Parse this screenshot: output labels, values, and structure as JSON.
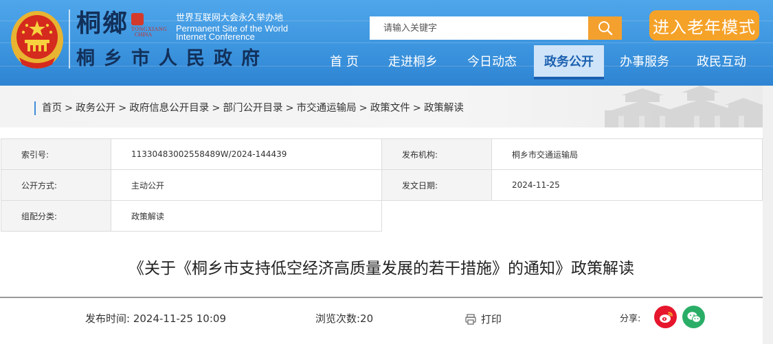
{
  "header": {
    "logo_calligraphy": "桐鄉",
    "logo_seal_en_1": "TONGXIANG",
    "logo_seal_en_2": "CHINA",
    "wic_cn": "世界互联网大会永久举办地",
    "wic_en_1": "Permanent Site of the World",
    "wic_en_2": "Internet Conference",
    "gov_name": "桐乡市人民政府",
    "search_placeholder": "请输入关键字",
    "elder_mode": "进入老年模式"
  },
  "nav": {
    "items": [
      {
        "label": "首 页"
      },
      {
        "label": "走进桐乡"
      },
      {
        "label": "今日动态"
      },
      {
        "label": "政务公开",
        "active": true
      },
      {
        "label": "办事服务"
      },
      {
        "label": "政民互动"
      }
    ]
  },
  "breadcrumb": {
    "items": [
      "首页",
      "政务公开",
      "政府信息公开目录",
      "部门公开目录",
      "市交通运输局",
      "政策文件",
      "政策解读"
    ],
    "separator": ">"
  },
  "info": {
    "index_label": "索引号:",
    "index_value": "11330483002558489W/2024-144439",
    "issuer_label": "发布机构:",
    "issuer_value": "桐乡市交通运输局",
    "mode_label": "公开方式:",
    "mode_value": "主动公开",
    "date_label": "发文日期:",
    "date_value": "2024-11-25",
    "category_label": "组配分类:",
    "category_value": "政策解读"
  },
  "article": {
    "title": "《关于《桐乡市支持低空经济高质量发展的若干措施》的通知》政策解读",
    "publish_time": "发布时间:  2024-11-25  10:09",
    "views": "浏览次数:20",
    "print_label": "打印",
    "share_label": "分享:"
  },
  "icons": {
    "search": "search-icon",
    "print": "printer-icon",
    "weibo": "weibo-icon",
    "wechat": "wechat-icon"
  },
  "colors": {
    "header_blue": "#3d95df",
    "nav_active_bg": "#cfe4f8",
    "accent_orange": "#f3a02e",
    "title_navy": "#12305a",
    "weibo_red": "#e6162d",
    "wechat_green": "#2aae67"
  }
}
